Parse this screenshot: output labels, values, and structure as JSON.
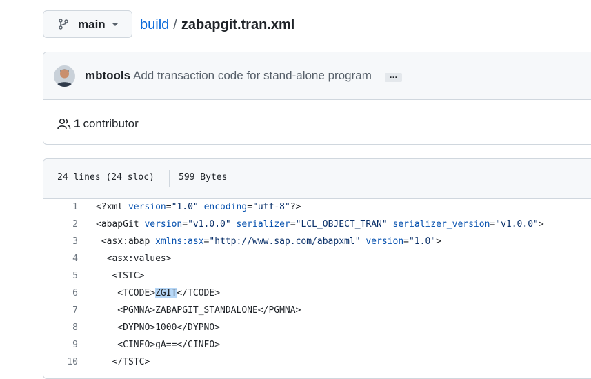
{
  "branch": {
    "name": "main",
    "icon": "git-branch-icon"
  },
  "breadcrumb": {
    "folder": "build",
    "separator": "/",
    "file": "zabapgit.tran.xml"
  },
  "commit": {
    "author": "mbtools",
    "message": "Add transaction code for stand-alone program",
    "more": "…"
  },
  "contributors": {
    "count": "1",
    "label": "contributor",
    "icon": "people-icon"
  },
  "file_info": {
    "lines": "24 lines (24 sloc)",
    "size": "599 Bytes"
  },
  "code": [
    {
      "n": "1",
      "parts": [
        [
          "t",
          "<?xml "
        ],
        [
          "a",
          "version"
        ],
        [
          "t",
          "="
        ],
        [
          "v",
          "\"1.0\""
        ],
        [
          "t",
          " "
        ],
        [
          "a",
          "encoding"
        ],
        [
          "t",
          "="
        ],
        [
          "v",
          "\"utf-8\""
        ],
        [
          "t",
          "?>"
        ]
      ]
    },
    {
      "n": "2",
      "parts": [
        [
          "t",
          "<abapGit "
        ],
        [
          "a",
          "version"
        ],
        [
          "t",
          "="
        ],
        [
          "v",
          "\"v1.0.0\""
        ],
        [
          "t",
          " "
        ],
        [
          "a",
          "serializer"
        ],
        [
          "t",
          "="
        ],
        [
          "v",
          "\"LCL_OBJECT_TRAN\""
        ],
        [
          "t",
          " "
        ],
        [
          "a",
          "serializer_version"
        ],
        [
          "t",
          "="
        ],
        [
          "v",
          "\"v1.0.0\""
        ],
        [
          "t",
          ">"
        ]
      ]
    },
    {
      "n": "3",
      "parts": [
        [
          "t",
          " <asx:abap "
        ],
        [
          "a",
          "xmlns:asx"
        ],
        [
          "t",
          "="
        ],
        [
          "v",
          "\"http://www.sap.com/abapxml\""
        ],
        [
          "t",
          " "
        ],
        [
          "a",
          "version"
        ],
        [
          "t",
          "="
        ],
        [
          "v",
          "\"1.0\""
        ],
        [
          "t",
          ">"
        ]
      ]
    },
    {
      "n": "4",
      "parts": [
        [
          "t",
          "  <asx:values>"
        ]
      ]
    },
    {
      "n": "5",
      "parts": [
        [
          "t",
          "   <TSTC>"
        ]
      ]
    },
    {
      "n": "6",
      "parts": [
        [
          "t",
          "    <TCODE>"
        ],
        [
          "h",
          "ZGIT"
        ],
        [
          "t",
          "</TCODE>"
        ]
      ]
    },
    {
      "n": "7",
      "parts": [
        [
          "t",
          "    <PGMNA>ZABAPGIT_STANDALONE</PGMNA>"
        ]
      ]
    },
    {
      "n": "8",
      "parts": [
        [
          "t",
          "    <DYPNO>1000</DYPNO>"
        ]
      ]
    },
    {
      "n": "9",
      "parts": [
        [
          "t",
          "    <CINFO>gA==</CINFO>"
        ]
      ]
    },
    {
      "n": "10",
      "parts": [
        [
          "t",
          "   </TSTC>"
        ]
      ]
    }
  ]
}
